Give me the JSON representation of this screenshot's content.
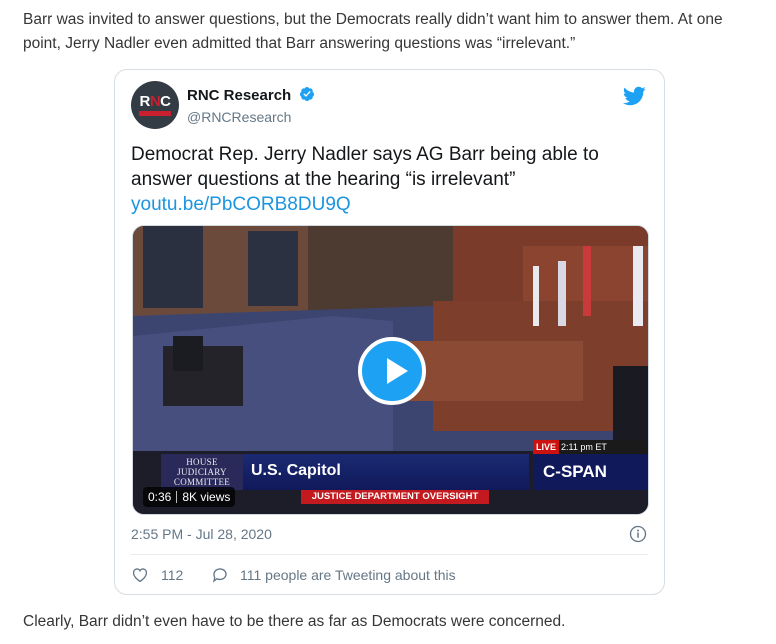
{
  "article": {
    "intro": "Barr was invited to answer questions, but the Democrats really didn’t want him to answer them. At one point, Jerry Nadler even admitted that Barr answering questions was “irrelevant.”",
    "outro": "Clearly, Barr didn’t even have to be there as far as Democrats were concerned."
  },
  "tweet": {
    "author_name": "RNC Research",
    "handle": "@RNCResearch",
    "avatar_text": "RNC",
    "text": "Democrat Rep. Jerry Nadler says AG Barr being able to answer questions at the hearing “is irrelevant”",
    "link": "youtu.be/PbCORB8DU9Q",
    "timestamp": "2:55 PM - Jul 28, 2020",
    "likes": "112",
    "conversation": "111 people are Tweeting about this",
    "icons": [
      "verified-icon",
      "twitter-bird-icon",
      "play-icon",
      "info-icon",
      "heart-icon",
      "comment-icon"
    ],
    "accent_color": "#1da1f2"
  },
  "video": {
    "duration": "0:36",
    "views": "8K views",
    "committee": "HOUSE JUDICIARY COMMITTEE",
    "location": "U.S. Capitol",
    "live": "LIVE",
    "live_time": "2:11 pm ET",
    "network": "C-SPAN",
    "banner": "JUSTICE DEPARTMENT OVERSIGHT"
  }
}
